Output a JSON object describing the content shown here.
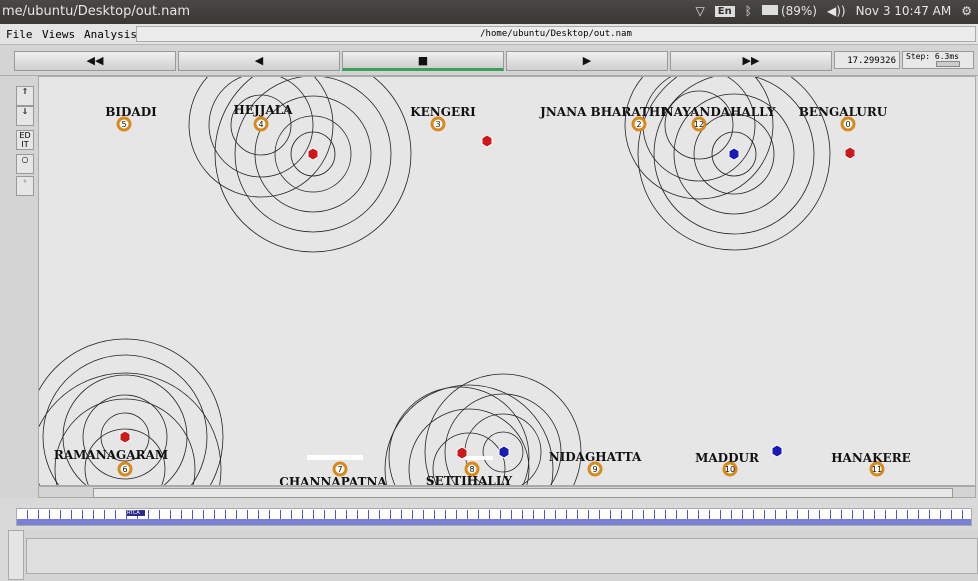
{
  "window": {
    "title": "me/ubuntu/Desktop/out.nam",
    "status": {
      "lang": "En",
      "battery": "(89%)",
      "clock": "Nov 3 10:47 AM"
    }
  },
  "menu": {
    "file": "File",
    "views": "Views",
    "analysis": "Analysis",
    "path": "/home/ubuntu/Desktop/out.nam"
  },
  "transport": {
    "rewind": "◀◀",
    "back": "◀",
    "stop": "■",
    "play": "▶",
    "fastforward": "▶▶",
    "time": "17.299326",
    "step": "Step: 6.3ms"
  },
  "left_tools": {
    "edit": "ED\nIT"
  },
  "nodes": [
    {
      "id": "0",
      "label": "BENGALURU",
      "color": "#d9881a"
    },
    {
      "id": "1",
      "label": "",
      "color": "#cc1a1a"
    },
    {
      "id": "2",
      "label": "JNANA BHARATHI",
      "color": "#d9881a"
    },
    {
      "id": "3",
      "label": "KENGERI",
      "color": "#d9881a"
    },
    {
      "id": "4",
      "label": "HEJJALA",
      "color": "#d9881a"
    },
    {
      "id": "5",
      "label": "BIDADI",
      "color": "#d9881a"
    },
    {
      "id": "6",
      "label": "RAMANAGARAM",
      "color": "#d9881a"
    },
    {
      "id": "7",
      "label": "CHANNAPATNA",
      "color": "#d9881a"
    },
    {
      "id": "8",
      "label": "SETTIHALLY",
      "color": "#d9881a"
    },
    {
      "id": "9",
      "label": "NIDAGHATTA",
      "color": "#d9881a"
    },
    {
      "id": "10",
      "label": "MADDUR",
      "color": "#d9881a"
    },
    {
      "id": "11",
      "label": "HANAKERE",
      "color": "#d9881a"
    },
    {
      "id": "12",
      "label": "NAYANDAHALLY",
      "color": "#d9881a"
    },
    {
      "id": "m1",
      "label": "",
      "color": "#cc1a1a"
    },
    {
      "id": "m2",
      "label": "",
      "color": "#cc1a1a"
    },
    {
      "id": "m3",
      "label": "",
      "color": "#1a1ab5"
    },
    {
      "id": "m4",
      "label": "",
      "color": "#cc1a1a"
    },
    {
      "id": "m5",
      "label": "",
      "color": "#cc1a1a"
    },
    {
      "id": "m6",
      "label": "",
      "color": "#1a1ab5"
    },
    {
      "id": "m7",
      "label": "",
      "color": "#1a1ab5"
    }
  ],
  "timeline": {
    "marker": "RTCA"
  }
}
